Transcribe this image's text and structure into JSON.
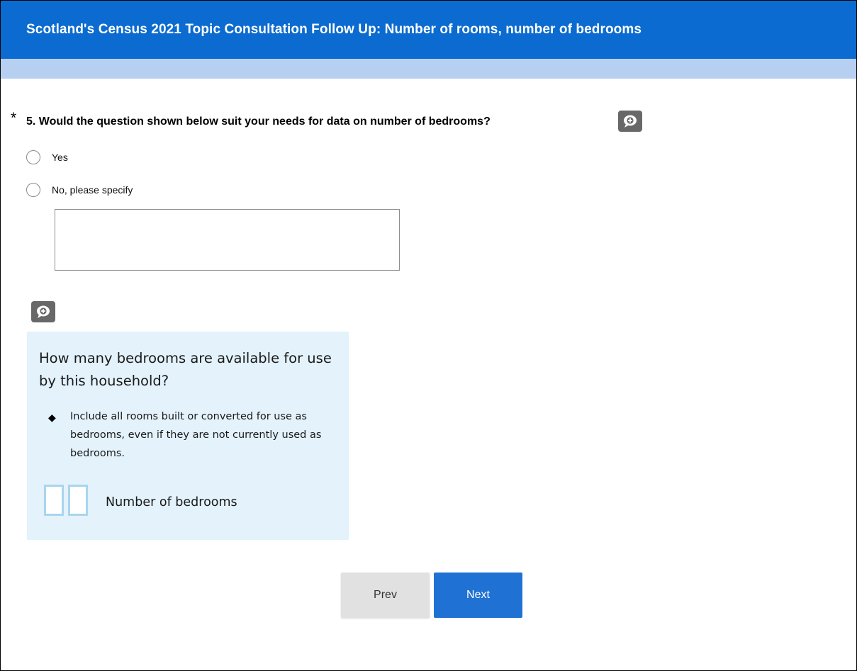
{
  "header": {
    "title": "Scotland's Census 2021 Topic Consultation Follow Up: Number of rooms, number of bedrooms"
  },
  "question": {
    "required_mark": "*",
    "title": "5. Would the question shown below suit your needs for data on number of bedrooms?",
    "options": [
      {
        "label": "Yes",
        "selected": false
      },
      {
        "label": "No, please specify",
        "selected": false
      }
    ],
    "specify_value": ""
  },
  "question_image": {
    "question_text": "How many bedrooms are available for use by this household?",
    "bullet": "◆",
    "guidance": "Include all rooms built or converted for use as bedrooms, even if they are not currently used as bedrooms.",
    "answer_label": "Number of bedrooms"
  },
  "icons": {
    "comment": "comment-add-icon",
    "radio": "radio-unchecked-icon"
  },
  "colors": {
    "header_bg": "#0b6bd0",
    "progress_bg": "#b7d0f2",
    "image_bg": "#e3f2fb",
    "next_button": "#1f72d3",
    "prev_button": "#e1e1e1",
    "comment_button": "#686868"
  },
  "nav": {
    "prev_label": "Prev",
    "next_label": "Next"
  }
}
